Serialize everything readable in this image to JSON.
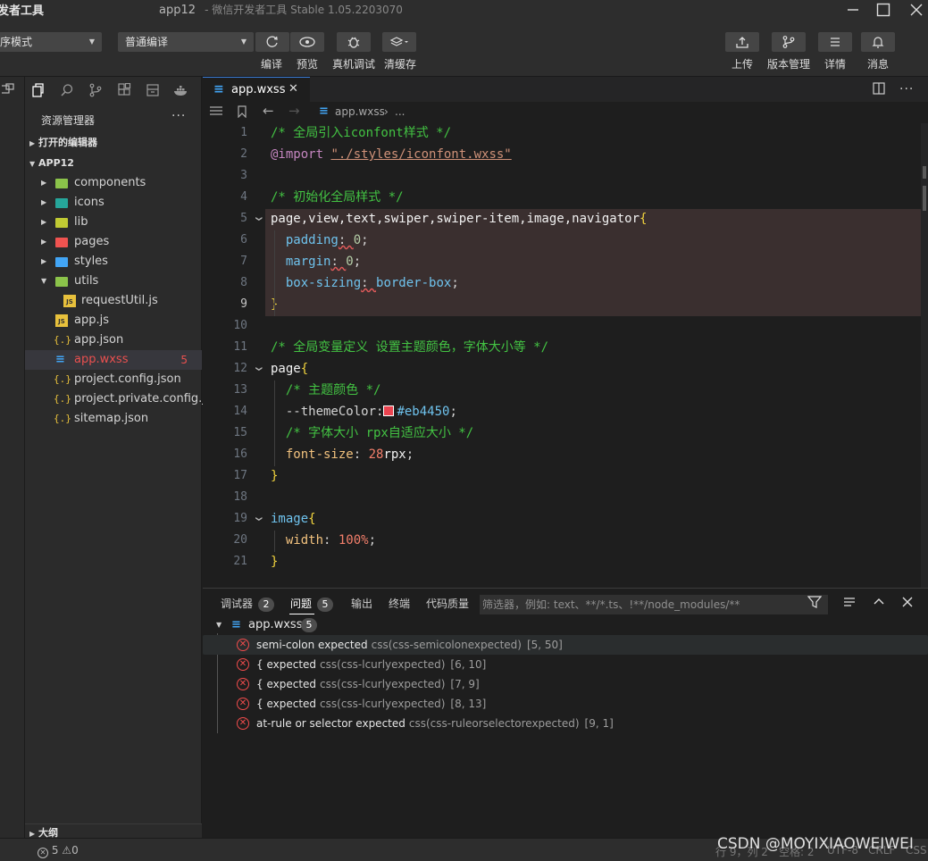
{
  "titlebar": {
    "app_name": "发者工具",
    "project": "app12",
    "subtitle": "- 微信开发者工具 Stable 1.05.2203070"
  },
  "toolbar": {
    "mode_select": "序模式",
    "compile_select": "普通编译",
    "buttons": [
      {
        "label": "编译"
      },
      {
        "label": "预览"
      },
      {
        "label": "真机调试"
      },
      {
        "label": "清缓存"
      }
    ],
    "right_buttons": [
      {
        "label": "上传"
      },
      {
        "label": "版本管理"
      },
      {
        "label": "详情"
      },
      {
        "label": "消息"
      }
    ]
  },
  "sidebar": {
    "title": "资源管理器",
    "more": "···",
    "open_editors": "打开的编辑器",
    "project_root": "APP12",
    "tree": [
      {
        "label": "components",
        "type": "folder",
        "color": "#8bc34a"
      },
      {
        "label": "icons",
        "type": "folder",
        "color": "#26a69a"
      },
      {
        "label": "lib",
        "type": "folder",
        "color": "#c0ca33"
      },
      {
        "label": "pages",
        "type": "folder",
        "color": "#ef5350"
      },
      {
        "label": "styles",
        "type": "folder",
        "color": "#42a5f5"
      },
      {
        "label": "utils",
        "type": "folder-open",
        "color": "#8bc34a"
      },
      {
        "label": "requestUtil.js",
        "type": "js"
      },
      {
        "label": "app.js",
        "type": "js"
      },
      {
        "label": "app.json",
        "type": "json"
      },
      {
        "label": "app.wxss",
        "type": "css",
        "badge": "5"
      },
      {
        "label": "project.config.json",
        "type": "json"
      },
      {
        "label": "project.private.config.js...",
        "type": "json"
      },
      {
        "label": "sitemap.json",
        "type": "json"
      }
    ],
    "outline": "大纲"
  },
  "editor": {
    "tab_label": "app.wxss",
    "breadcrumb_file": "app.wxss",
    "breadcrumb_more": "...",
    "lines": [
      {
        "n": "1",
        "parts": [
          [
            "c-cm",
            "/* 全局引入iconfont样式 */"
          ]
        ]
      },
      {
        "n": "2",
        "parts": [
          [
            "c-at",
            "@import "
          ],
          [
            "c-str",
            "\"./styles/iconfont.wxss\""
          ]
        ]
      },
      {
        "n": "3",
        "parts": []
      },
      {
        "n": "4",
        "parts": [
          [
            "c-cm",
            "/* 初始化全局样式 */"
          ]
        ]
      },
      {
        "n": "5",
        "parts": [
          [
            "c-sel",
            "page,view,text,swiper,swiper-item,image,navigator"
          ],
          [
            "c-brace",
            "{"
          ]
        ]
      },
      {
        "n": "6",
        "parts": [
          [
            "c-kw",
            "  padding"
          ],
          [
            "",
            ": "
          ],
          [
            "c-val",
            "0"
          ],
          [
            "",
            ";"
          ]
        ]
      },
      {
        "n": "7",
        "parts": [
          [
            "c-kw",
            "  margin"
          ],
          [
            "",
            ": "
          ],
          [
            "c-val",
            "0"
          ],
          [
            "",
            ";"
          ]
        ]
      },
      {
        "n": "8",
        "parts": [
          [
            "c-kw",
            "  box-sizing"
          ],
          [
            "",
            ": "
          ],
          [
            "c-kw",
            "border-box"
          ],
          [
            "",
            ";"
          ]
        ]
      },
      {
        "n": "9",
        "parts": [
          [
            "c-brace",
            "}"
          ]
        ]
      },
      {
        "n": "10",
        "parts": []
      },
      {
        "n": "11",
        "parts": [
          [
            "c-cm",
            "/* 全局变量定义 设置主题颜色，字体大小等 */"
          ]
        ]
      },
      {
        "n": "12",
        "parts": [
          [
            "c-sel",
            "page"
          ],
          [
            "c-brace",
            "{"
          ]
        ]
      },
      {
        "n": "13",
        "parts": [
          [
            "c-cm",
            "  /* 主题颜色 */"
          ]
        ]
      },
      {
        "n": "14",
        "parts": [
          [
            "",
            "  --themeColor:"
          ],
          [
            "swatch",
            ""
          ],
          [
            "c-kw",
            "#eb4450"
          ],
          [
            "",
            ";"
          ]
        ]
      },
      {
        "n": "15",
        "parts": [
          [
            "c-cm",
            "  /* 字体大小 rpx自适应大小 */"
          ]
        ]
      },
      {
        "n": "16",
        "parts": [
          [
            "c-prop",
            "  font-size"
          ],
          [
            "",
            ": "
          ],
          [
            "c-num",
            "28"
          ],
          [
            "c-sel",
            "rpx"
          ],
          [
            "",
            ";"
          ]
        ]
      },
      {
        "n": "17",
        "parts": [
          [
            "c-brace",
            "}"
          ]
        ]
      },
      {
        "n": "18",
        "parts": []
      },
      {
        "n": "19",
        "parts": [
          [
            "c-kw",
            "image"
          ],
          [
            "c-brace",
            "{"
          ]
        ]
      },
      {
        "n": "20",
        "parts": [
          [
            "c-prop",
            "  width"
          ],
          [
            "",
            ": "
          ],
          [
            "c-num",
            "100%"
          ],
          [
            "",
            ";"
          ]
        ]
      },
      {
        "n": "21",
        "parts": [
          [
            "c-brace",
            "}"
          ]
        ]
      }
    ]
  },
  "panel": {
    "tabs": [
      {
        "label": "调试器",
        "badge": "2"
      },
      {
        "label": "问题",
        "badge": "5"
      },
      {
        "label": "输出"
      },
      {
        "label": "终端"
      },
      {
        "label": "代码质量"
      }
    ],
    "filter_placeholder": "筛选器，例如: text、**/*.ts、!**/node_modules/**",
    "group_file": "app.wxss",
    "group_count": "5",
    "problems": [
      {
        "msg": "semi-colon expected",
        "src": "css(css-semicolonexpected)",
        "pos": "[5, 50]"
      },
      {
        "msg": "{ expected",
        "src": "css(css-lcurlyexpected)",
        "pos": "[6, 10]"
      },
      {
        "msg": "{ expected",
        "src": "css(css-lcurlyexpected)",
        "pos": "[7, 9]"
      },
      {
        "msg": "{ expected",
        "src": "css(css-lcurlyexpected)",
        "pos": "[8, 13]"
      },
      {
        "msg": "at-rule or selector expected",
        "src": "css(css-ruleorselectorexpected)",
        "pos": "[9, 1]"
      }
    ]
  },
  "statusbar": {
    "errors": "5",
    "warnings": "0",
    "position": "行 9，列 2",
    "spaces": "空格: 2",
    "encoding": "UTF-8",
    "eol": "CRLF",
    "lang": "CSS"
  },
  "watermark": "CSDN @MOYIXIAOWEIWEI"
}
